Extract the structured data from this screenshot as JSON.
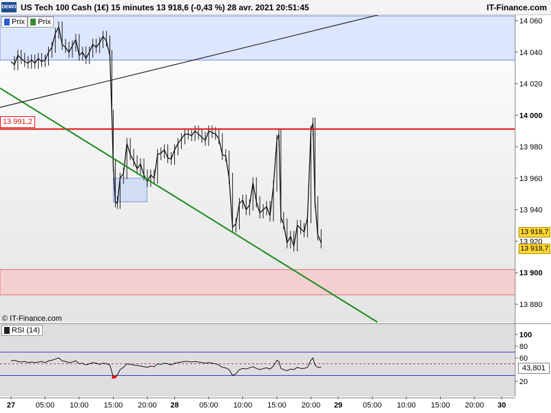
{
  "header": {
    "demo_badge": "DEMO",
    "title": "US Tech 100 Cash (1€) 15 minutes 13 918,6 (-0,43 %) 28 avr. 2021 20:51:45",
    "brand": "IT-Finance.com"
  },
  "legend": {
    "items": [
      {
        "label": "Prix",
        "color": "#2d5fd4"
      },
      {
        "label": "Prix",
        "color": "#3a8a3a"
      }
    ],
    "rsi_label": "RSI (14)",
    "copyright": "© IT-Finance.com"
  },
  "price_axis": {
    "ticks": [
      {
        "value": 14060,
        "label": "14 060"
      },
      {
        "value": 14040,
        "label": "14 040"
      },
      {
        "value": 14020,
        "label": "14 020"
      },
      {
        "value": 14000,
        "label": "14 000"
      },
      {
        "value": 13980,
        "label": "13 980"
      },
      {
        "value": 13960,
        "label": "13 960"
      },
      {
        "value": 13940,
        "label": "13 940"
      },
      {
        "value": 13920,
        "label": "13 920"
      },
      {
        "value": 13900,
        "label": "13 900"
      },
      {
        "value": 13880,
        "label": "13 880"
      }
    ],
    "last_price_labels": [
      "13 918,7",
      "13 918,7"
    ]
  },
  "rsi_axis": {
    "ticks": [
      {
        "value": 100,
        "label": "100"
      },
      {
        "value": 80,
        "label": "80"
      },
      {
        "value": 60,
        "label": "60"
      },
      {
        "value": 20,
        "label": "20"
      }
    ],
    "current_label": "43,801",
    "current_value": 43.801,
    "overbought": 70,
    "oversold": 30
  },
  "time_axis": {
    "ticks": [
      {
        "label": "27",
        "bold": true,
        "hour": 0
      },
      {
        "label": "05:00",
        "bold": false,
        "hour": 5
      },
      {
        "label": "10:00",
        "bold": false,
        "hour": 10
      },
      {
        "label": "15:00",
        "bold": false,
        "hour": 15
      },
      {
        "label": "20:00",
        "bold": false,
        "hour": 20
      },
      {
        "label": "28",
        "bold": true,
        "hour": 24
      },
      {
        "label": "05:00",
        "bold": false,
        "hour": 29
      },
      {
        "label": "10:00",
        "bold": false,
        "hour": 34
      },
      {
        "label": "15:00",
        "bold": false,
        "hour": 39
      },
      {
        "label": "20:00",
        "bold": false,
        "hour": 44
      },
      {
        "label": "29",
        "bold": true,
        "hour": 48
      },
      {
        "label": "05:00",
        "bold": false,
        "hour": 53
      },
      {
        "label": "10:00",
        "bold": false,
        "hour": 58
      },
      {
        "label": "15:00",
        "bold": false,
        "hour": 63
      },
      {
        "label": "20:00",
        "bold": false,
        "hour": 68
      },
      {
        "label": "30",
        "bold": true,
        "hour": 72
      }
    ]
  },
  "annotations": {
    "resistance_label": "13 991,2",
    "resistance_value": 13991.2,
    "resistance_color": "#e01010",
    "trendline_color": "#1a8a1a",
    "upper_line_color": "#222222",
    "upper_zone": {
      "from": 14035,
      "to": 14063,
      "color": "#dde6ff"
    },
    "support_zone": {
      "from": 13886,
      "to": 13902,
      "color": "#f3cfcf"
    },
    "box_zone": {
      "from_hour": 15.0,
      "to_hour": 20.0,
      "from": 13945,
      "to": 13960,
      "color": "#c9d8f2"
    }
  },
  "chart_data": {
    "type": "line",
    "title": "US Tech 100 Cash (1€) 15 minutes",
    "x_unit": "hours from 27 Apr 2021 00:00",
    "xlim": [
      0,
      75
    ],
    "ylim": [
      13872,
      14063
    ],
    "series": [
      {
        "name": "Prix",
        "x": [
          0,
          0.5,
          1,
          1.5,
          2,
          2.5,
          3,
          3.5,
          4,
          4.5,
          5,
          5.5,
          6,
          6.5,
          7,
          7.5,
          8,
          8.5,
          9,
          9.5,
          10,
          10.5,
          11,
          11.5,
          12,
          12.5,
          13,
          13.5,
          14,
          14.5,
          14.8,
          15,
          15.3,
          15.6,
          16,
          16.5,
          17,
          17.5,
          18,
          18.5,
          19,
          19.5,
          20,
          20.5,
          21,
          21.5,
          22,
          22.5,
          23,
          23.5,
          24,
          24.5,
          25,
          25.5,
          26,
          26.5,
          27,
          27.5,
          28,
          28.5,
          29,
          29.5,
          30,
          30.5,
          31,
          31.5,
          32,
          32.5,
          33,
          33.5,
          34,
          34.5,
          35,
          35.5,
          36,
          36.5,
          37,
          37.5,
          38,
          38.5,
          39,
          39.3,
          39.6,
          40,
          40.5,
          41,
          41.5,
          42,
          42.5,
          43,
          43.5,
          44,
          44.3,
          44.6,
          45,
          45.5
        ],
        "values": [
          14034,
          14032,
          14038,
          14036,
          14034,
          14033,
          14035,
          14033,
          14036,
          14034,
          14035,
          14040,
          14043,
          14052,
          14056,
          14045,
          14043,
          14040,
          14044,
          14048,
          14038,
          14040,
          14036,
          14040,
          14045,
          14043,
          14046,
          14050,
          14047,
          14038,
          14000,
          13968,
          13945,
          13944,
          13960,
          13963,
          13982,
          13975,
          13971,
          13966,
          13969,
          13962,
          13958,
          13962,
          13960,
          13975,
          13976,
          13978,
          13973,
          13972,
          13978,
          13982,
          13985,
          13988,
          13988,
          13987,
          13990,
          13988,
          13986,
          13984,
          13990,
          13989,
          13988,
          13985,
          13975,
          13974,
          13960,
          13929,
          13931,
          13944,
          13946,
          13940,
          13943,
          13957,
          13945,
          13938,
          13940,
          13942,
          13936,
          13955,
          13984,
          13988,
          13935,
          13931,
          13919,
          13923,
          13917,
          13930,
          13928,
          13926,
          13935,
          13990,
          13995,
          13945,
          13924,
          13919
        ]
      }
    ],
    "rsi_series": {
      "name": "RSI (14)",
      "values": [
        55,
        56,
        54,
        53,
        54,
        52,
        53,
        52,
        53,
        54,
        52,
        55,
        56,
        58,
        60,
        55,
        54,
        52,
        53,
        55,
        50,
        51,
        48,
        50,
        52,
        51,
        49,
        51,
        50,
        48,
        36,
        27,
        28,
        31,
        40,
        44,
        50,
        49,
        48,
        47,
        46,
        45,
        44,
        46,
        45,
        50,
        49,
        51,
        50,
        48,
        51,
        52,
        53,
        54,
        54,
        53,
        54,
        53,
        52,
        51,
        52,
        51,
        50,
        48,
        44,
        43,
        40,
        30,
        33,
        40,
        42,
        41,
        43,
        45,
        42,
        40,
        42,
        43,
        41,
        46,
        56,
        54,
        42,
        40,
        38,
        41,
        40,
        44,
        42,
        42,
        44,
        56,
        60,
        48,
        44,
        44
      ]
    },
    "levels": {
      "horizontal": [
        13991.2
      ]
    }
  }
}
